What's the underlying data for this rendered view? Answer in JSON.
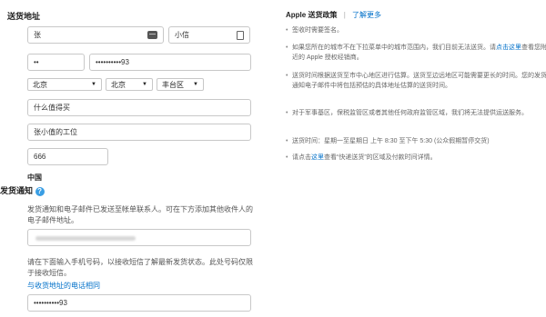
{
  "shipping": {
    "title": "送货地址",
    "last_name": "张",
    "first_name": "小信",
    "area_code": "••",
    "phone": "••••••••••93",
    "province": "北京",
    "city": "北京",
    "district": "丰台区",
    "address_line1": "什么值得买",
    "address_line2": "张小值的工位",
    "postal_code": "666",
    "country": "中国"
  },
  "notification": {
    "title": "发货通知",
    "help_icon": "?",
    "email_desc": "发货通知和电子邮件已发送至帐单联系人。可在下方添加其他收件人的电子邮件地址。",
    "sms_desc": "请在下面输入手机号码，以接收短信了解最新发货状态。此处号码仅限于接收短信。",
    "same_phone_link": "与收货地址的电话相同",
    "sms_phone": "••••••••••93"
  },
  "policy": {
    "title": "Apple 送货政策",
    "separator": "|",
    "learn_more": "了解更多",
    "items": [
      {
        "text": "签收时需要签名。"
      },
      {
        "text_before": "如果您所在的城市不在下拉菜单中的城市范围内，我们目前无法送货。请",
        "link": "点击这里",
        "text_after": "查看您附近的 Apple 授权经销商。"
      },
      {
        "text": "送货时间根据送货至市中心地区进行估算。送货至边远地区可能需要更长的时间。您的发货通知电子邮件中将包括预估的具体地址估算的送货时间。"
      },
      {
        "text": "对于军事基区，保税监管区或者其他任何政府监管区域，我们将无法提供运送服务。"
      },
      {
        "text": "送货时间：星期一至星期日 上午 8:30 至下午 5:30 (公众假期暂停交货)"
      },
      {
        "text_before": "请点击",
        "link": "这里",
        "text_after": "查看“快递送货”的区域及付款时间详情。"
      }
    ]
  },
  "icons": {
    "card": "card-icon",
    "contact": "contact-card-icon",
    "help": "help-icon"
  }
}
